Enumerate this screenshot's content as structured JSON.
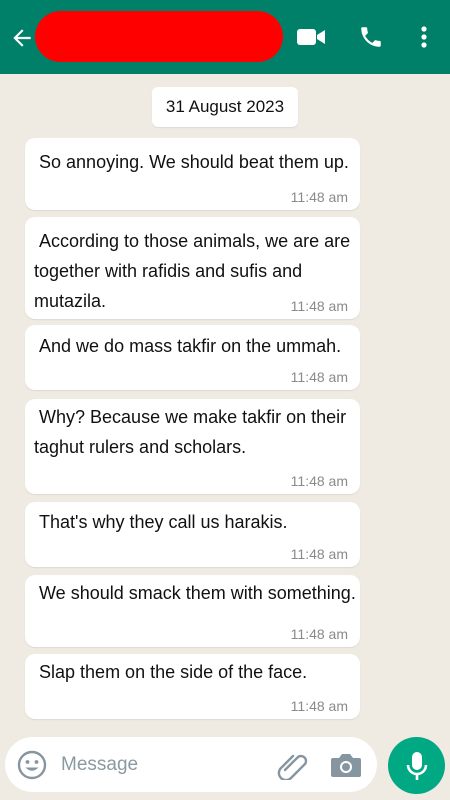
{
  "header": {
    "back_icon": "arrow-left-icon",
    "contact_name_redacted": true,
    "video_icon": "video-camera-icon",
    "call_icon": "phone-icon",
    "menu_icon": "more-vert-icon"
  },
  "chat": {
    "date": "31 August 2023",
    "messages": [
      {
        "text": " So annoying. We should beat them up.",
        "time": "11:48 am"
      },
      {
        "text": " According to those animals, we are are together with rafidis and sufis and mutazila.",
        "time": "11:48 am"
      },
      {
        "text": " And we do mass takfir on the ummah.",
        "time": "11:48 am"
      },
      {
        "text": " Why? Because we make takfir on their taghut rulers and scholars.",
        "time": "11:48 am"
      },
      {
        "text": " That's why they call us harakis.",
        "time": "11:48 am"
      },
      {
        "text": " We should smack them with something.",
        "time": "11:48 am"
      },
      {
        "text": " Slap them on the side of the face.",
        "time": "11:48 am"
      }
    ]
  },
  "composer": {
    "placeholder": "Message",
    "emoji_icon": "emoji-icon",
    "attach_icon": "paperclip-icon",
    "camera_icon": "camera-icon",
    "mic_icon": "microphone-icon"
  },
  "colors": {
    "header": "#008069",
    "chat_background": "#efeae2",
    "bubble": "#ffffff",
    "mic_button": "#00a884",
    "redaction": "#ff0000"
  }
}
